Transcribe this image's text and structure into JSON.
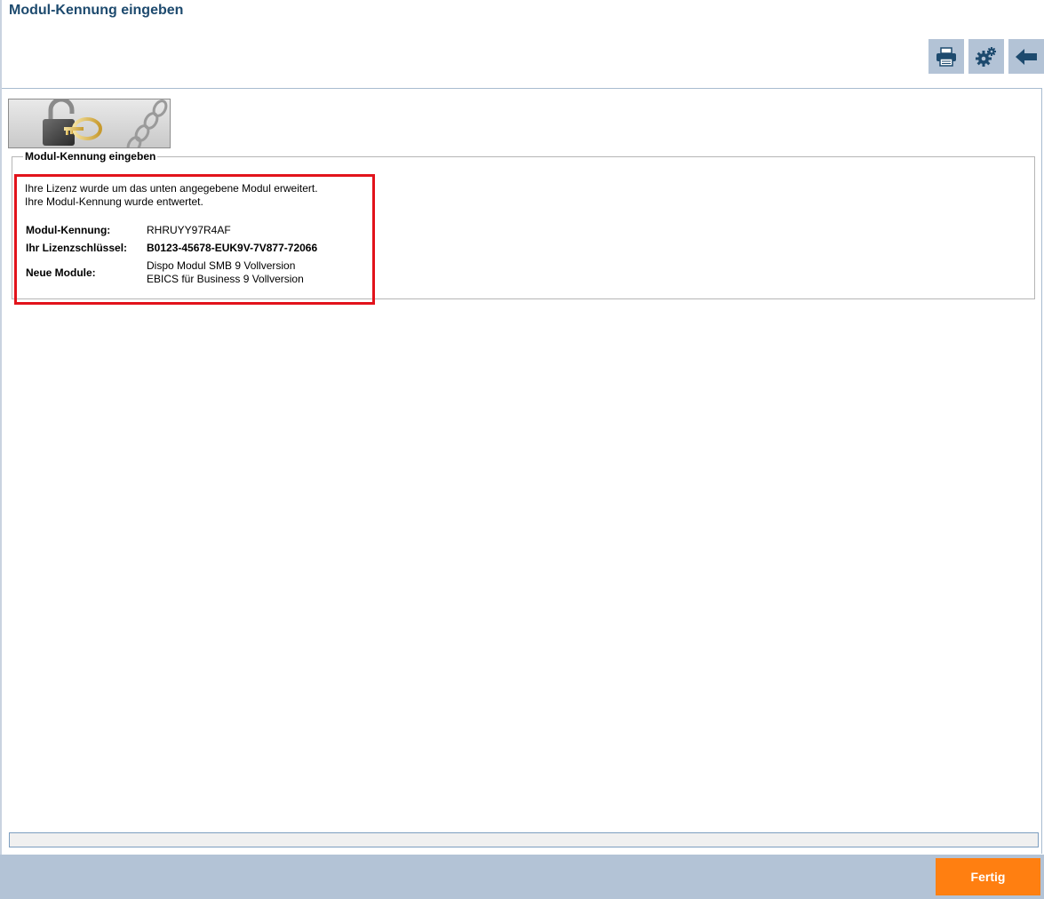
{
  "header": {
    "title": "Modul-Kennung eingeben"
  },
  "toolbar": {
    "buttons": [
      {
        "icon": "printer-icon"
      },
      {
        "icon": "gears-icon"
      },
      {
        "icon": "back-arrow-icon"
      }
    ]
  },
  "group": {
    "legend": "Modul-Kennung eingeben",
    "message_line1": "Ihre Lizenz wurde um das unten angegebene Modul erweitert.",
    "message_line2": "Ihre Modul-Kennung wurde entwertet.",
    "fields": {
      "modul_kennung_label": "Modul-Kennung:",
      "modul_kennung_value": "RHRUYY97R4AF",
      "lizenzschluessel_label": "Ihr Lizenzschlüssel:",
      "lizenzschluessel_value": "B0123-45678-EUK9V-7V877-72066",
      "neue_module_label": "Neue Module:",
      "neue_module_values": [
        "Dispo Modul SMB 9 Vollversion",
        "EBICS für Business 9 Vollversion"
      ]
    }
  },
  "footer": {
    "done_label": "Fertig"
  },
  "colors": {
    "title": "#1d4a6e",
    "toolbar_bg": "#b3c3d6",
    "highlight_border": "#e2131b",
    "done_button": "#ff7f11"
  }
}
